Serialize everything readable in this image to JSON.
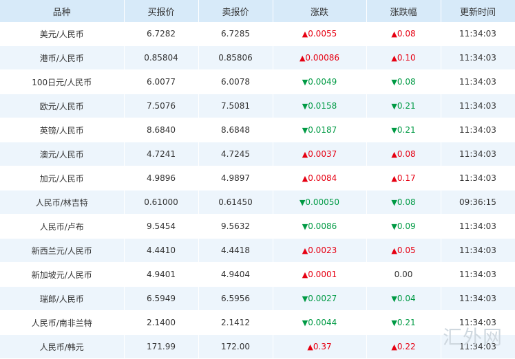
{
  "columns": {
    "name": "品种",
    "bid": "买报价",
    "ask": "卖报价",
    "change": "涨跌",
    "pct": "涨跌幅",
    "time": "更新时间"
  },
  "rows": [
    {
      "name": "美元/人民币",
      "bid": "6.7282",
      "ask": "6.7285",
      "dir": "up",
      "change": "0.0055",
      "pct": "0.08",
      "time": "11:34:03"
    },
    {
      "name": "港币/人民币",
      "bid": "0.85804",
      "ask": "0.85806",
      "dir": "up",
      "change": "0.00086",
      "pct": "0.10",
      "time": "11:34:03"
    },
    {
      "name": "100日元/人民币",
      "bid": "6.0077",
      "ask": "6.0078",
      "dir": "down",
      "change": "0.0049",
      "pct": "0.08",
      "time": "11:34:03"
    },
    {
      "name": "欧元/人民币",
      "bid": "7.5076",
      "ask": "7.5081",
      "dir": "down",
      "change": "0.0158",
      "pct": "0.21",
      "time": "11:34:03"
    },
    {
      "name": "英镑/人民币",
      "bid": "8.6840",
      "ask": "8.6848",
      "dir": "down",
      "change": "0.0187",
      "pct": "0.21",
      "time": "11:34:03"
    },
    {
      "name": "澳元/人民币",
      "bid": "4.7241",
      "ask": "4.7245",
      "dir": "up",
      "change": "0.0037",
      "pct": "0.08",
      "time": "11:34:03"
    },
    {
      "name": "加元/人民币",
      "bid": "4.9896",
      "ask": "4.9897",
      "dir": "up",
      "change": "0.0084",
      "pct": "0.17",
      "time": "11:34:03"
    },
    {
      "name": "人民币/林吉特",
      "bid": "0.61000",
      "ask": "0.61450",
      "dir": "down",
      "change": "0.00050",
      "pct": "0.08",
      "time": "09:36:15"
    },
    {
      "name": "人民币/卢布",
      "bid": "9.5454",
      "ask": "9.5632",
      "dir": "down",
      "change": "0.0086",
      "pct": "0.09",
      "time": "11:34:03"
    },
    {
      "name": "新西兰元/人民币",
      "bid": "4.4410",
      "ask": "4.4418",
      "dir": "up",
      "change": "0.0023",
      "pct": "0.05",
      "time": "11:34:03"
    },
    {
      "name": "新加坡元/人民币",
      "bid": "4.9401",
      "ask": "4.9404",
      "dir": "up",
      "change": "0.0001",
      "pct": "0.00",
      "pct_dir": "flat",
      "time": "11:34:03"
    },
    {
      "name": "瑞郎/人民币",
      "bid": "6.5949",
      "ask": "6.5956",
      "dir": "down",
      "change": "0.0027",
      "pct": "0.04",
      "time": "11:34:03"
    },
    {
      "name": "人民币/南非兰特",
      "bid": "2.1400",
      "ask": "2.1412",
      "dir": "down",
      "change": "0.0044",
      "pct": "0.21",
      "time": "11:34:03"
    },
    {
      "name": "人民币/韩元",
      "bid": "171.99",
      "ask": "172.00",
      "dir": "up",
      "change": "0.37",
      "pct": "0.22",
      "time": "11:34:03"
    }
  ],
  "arrows": {
    "up": "▲",
    "down": "▼",
    "flat": ""
  },
  "colors": {
    "up": "#e60012",
    "down": "#009a44",
    "header_bg": "#d7eaf9",
    "stripe_bg": "#edf5fc"
  },
  "watermark": "汇外网"
}
